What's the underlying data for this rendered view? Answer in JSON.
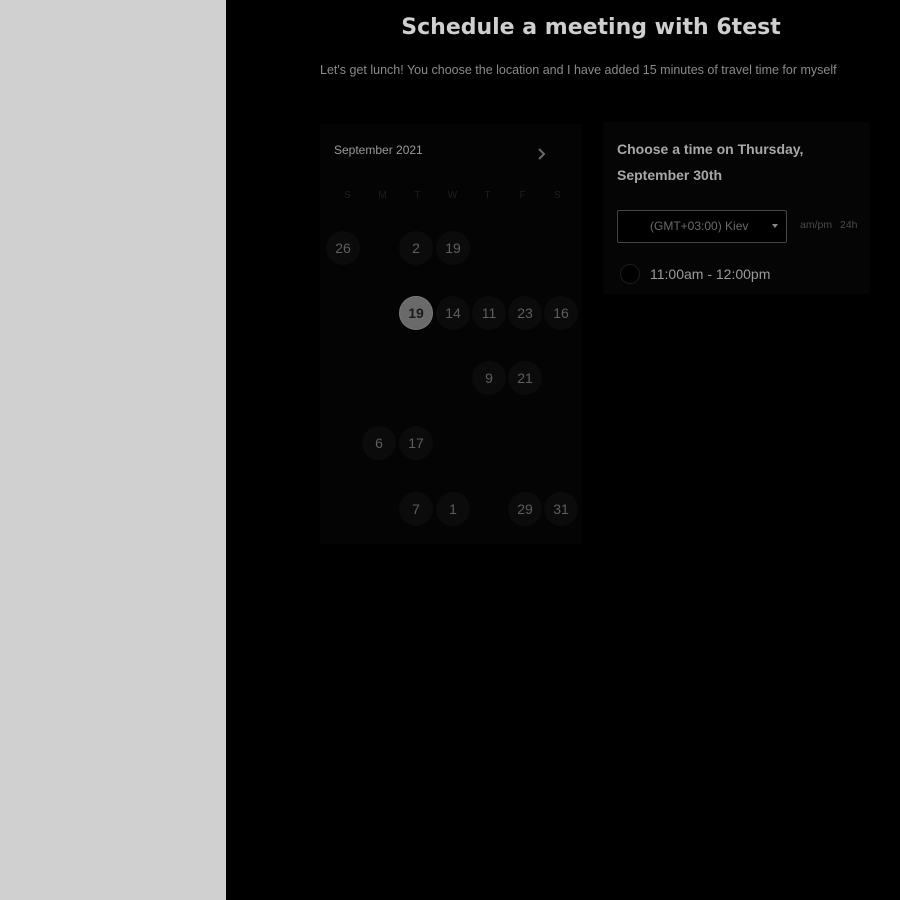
{
  "header": {
    "title": "Schedule a meeting with 6test",
    "subtitle": "Let's get lunch! You choose the location and I have added 15 minutes of travel time for myself"
  },
  "calendar": {
    "month_label": "September 2021",
    "next_icon": "chevron-right-icon",
    "weekdays": [
      "S",
      "M",
      "T",
      "W",
      "T",
      "F",
      "S"
    ],
    "days": [
      {
        "label": "26",
        "col": 0,
        "row": 0,
        "state": "normal"
      },
      {
        "label": "2",
        "col": 2,
        "row": 0,
        "state": "normal"
      },
      {
        "label": "19",
        "col": 3,
        "row": 0,
        "state": "normal"
      },
      {
        "label": "19",
        "col": 2,
        "row": 1,
        "state": "selected"
      },
      {
        "label": "14",
        "col": 3,
        "row": 1,
        "state": "normal"
      },
      {
        "label": "11",
        "col": 4,
        "row": 1,
        "state": "normal"
      },
      {
        "label": "23",
        "col": 5,
        "row": 1,
        "state": "normal"
      },
      {
        "label": "16",
        "col": 6,
        "row": 1,
        "state": "normal"
      },
      {
        "label": "9",
        "col": 4,
        "row": 2,
        "state": "normal"
      },
      {
        "label": "21",
        "col": 5,
        "row": 2,
        "state": "normal"
      },
      {
        "label": "6",
        "col": 1,
        "row": 3,
        "state": "normal"
      },
      {
        "label": "17",
        "col": 2,
        "row": 3,
        "state": "normal"
      },
      {
        "label": "7",
        "col": 2,
        "row": 4,
        "state": "normal"
      },
      {
        "label": "1",
        "col": 3,
        "row": 4,
        "state": "normal"
      },
      {
        "label": "29",
        "col": 5,
        "row": 4,
        "state": "normal"
      },
      {
        "label": "31",
        "col": 6,
        "row": 4,
        "state": "normal"
      }
    ]
  },
  "time_panel": {
    "heading": "Choose a time on Thursday, September 30th",
    "timezone": {
      "value": "(GMT+03:00) Kiev"
    },
    "format_ampm": "am/pm",
    "format_24h": "24h",
    "slots": [
      {
        "label": "11:00am - 12:00pm"
      }
    ]
  },
  "colors": {
    "sidebar": "#d0d0d0",
    "background": "#000000"
  }
}
